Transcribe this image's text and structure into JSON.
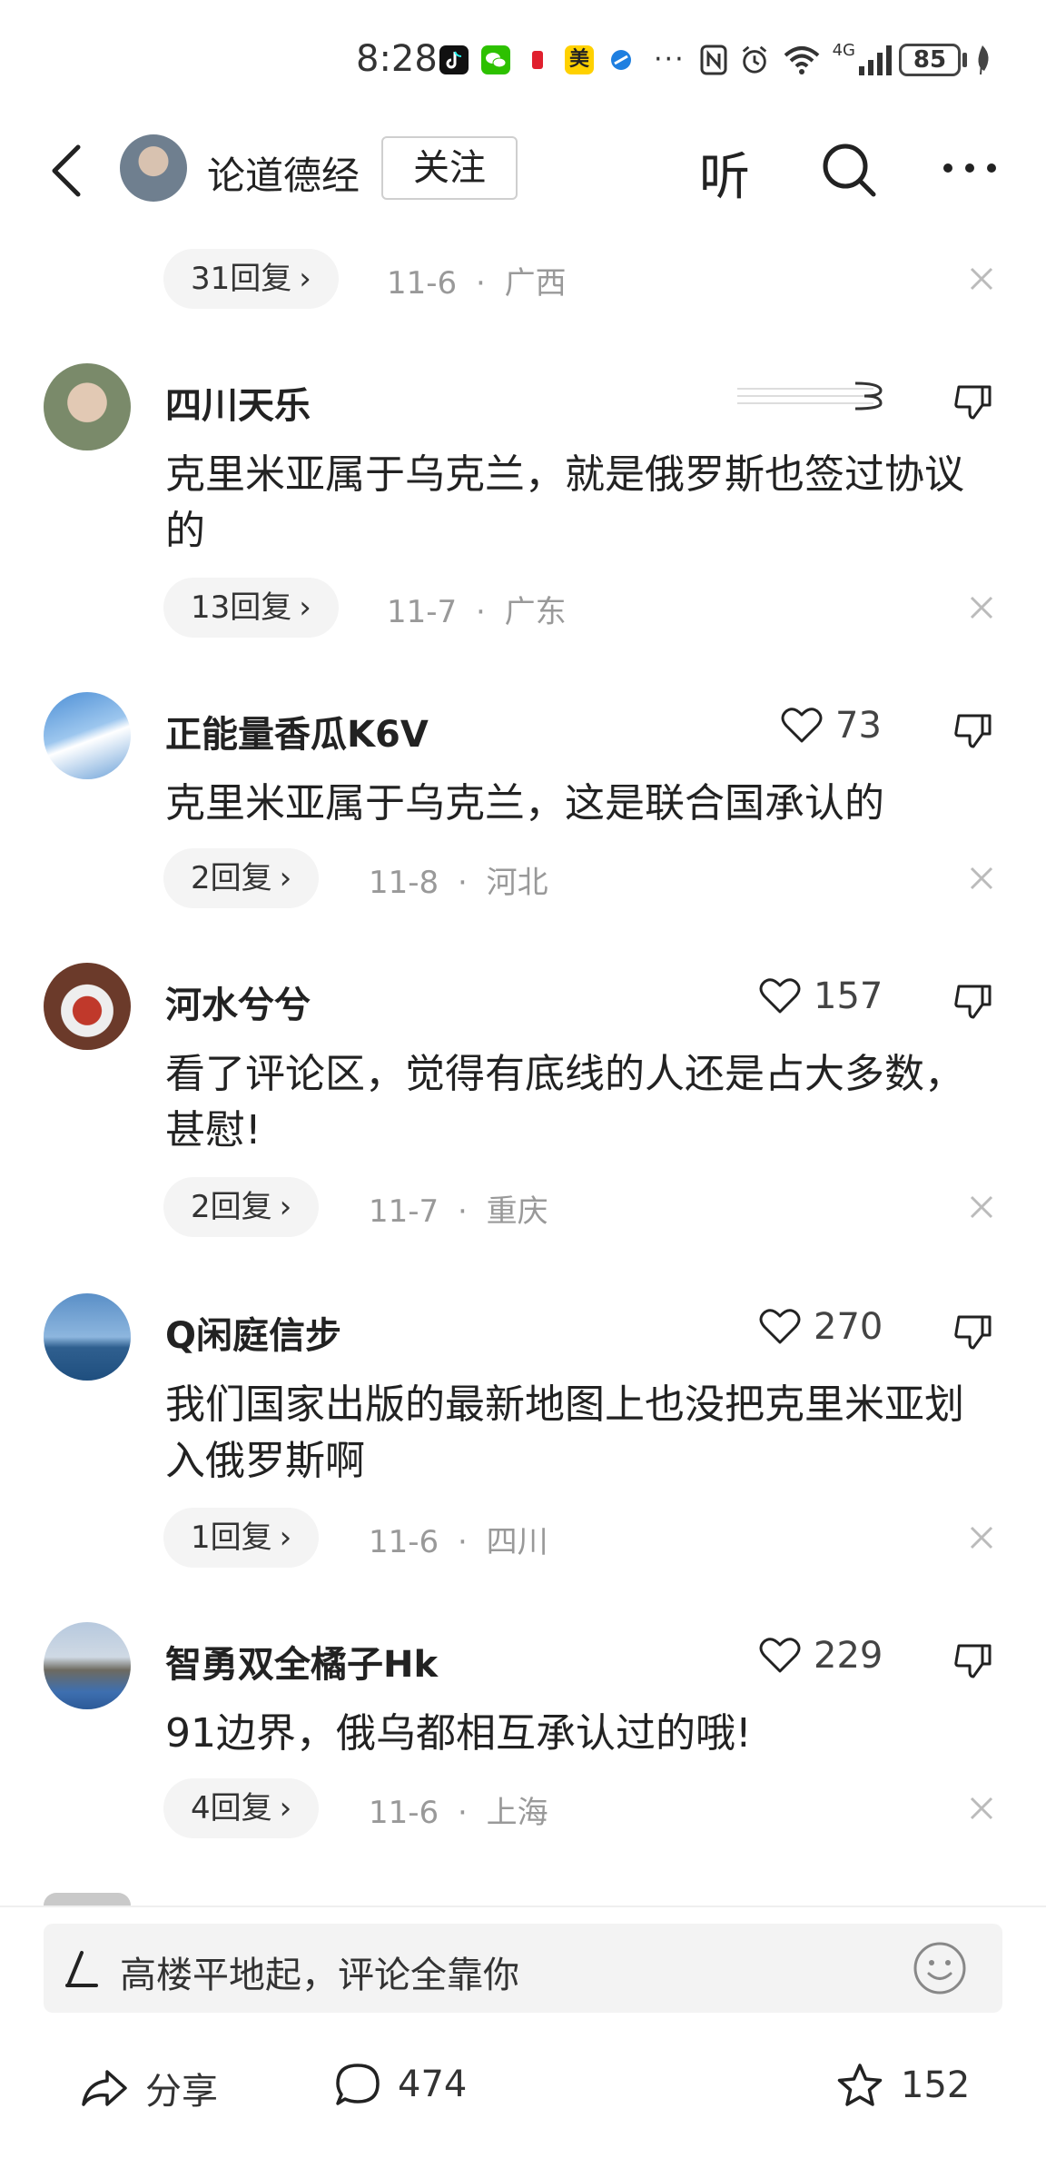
{
  "status_bar": {
    "time": "8:28",
    "app_icons": [
      "tiktok-icon",
      "wechat-icon",
      "red-app-icon",
      "meituan-icon",
      "blue-app-icon"
    ],
    "meituan_label": "美",
    "more_dots": "···",
    "battery": "85",
    "network": "4G"
  },
  "header": {
    "author_name": "论道德经",
    "follow_label": "关注",
    "listen_label": "听"
  },
  "top_reply": {
    "reply_count": "31回复",
    "date": "11-6",
    "separator": "·",
    "location": "广西"
  },
  "comments": [
    {
      "username": "四川天乐",
      "likes": "",
      "text": "克里米亚属于乌克兰，就是俄罗斯也签过协议的",
      "reply_count": "13回复",
      "date": "11-7",
      "location": "广东"
    },
    {
      "username": "正能量香瓜K6V",
      "likes": "73",
      "text": "克里米亚属于乌克兰，这是联合国承认的",
      "reply_count": "2回复",
      "date": "11-8",
      "location": "河北"
    },
    {
      "username": "河水兮兮",
      "likes": "157",
      "text": "看了评论区，觉得有底线的人还是占大多数，甚慰!",
      "reply_count": "2回复",
      "date": "11-7",
      "location": "重庆"
    },
    {
      "username": "Q闲庭信步",
      "likes": "270",
      "text": "我们国家出版的最新地图上也没把克里米亚划入俄罗斯啊",
      "reply_count": "1回复",
      "date": "11-6",
      "location": "四川"
    },
    {
      "username": "智勇双全橘子Hk",
      "likes": "229",
      "text": "91边界，俄乌都相互承认过的哦!",
      "reply_count": "4回复",
      "date": "11-6",
      "location": "上海"
    }
  ],
  "input": {
    "placeholder": "高楼平地起，评论全靠你"
  },
  "actions": {
    "share_label": "分享",
    "comment_count": "474",
    "favorite_count": "152"
  },
  "colors": {
    "text": "#222222",
    "meta": "#999999",
    "pill_bg": "#f4f4f4",
    "input_bg": "#f3f3f3"
  }
}
